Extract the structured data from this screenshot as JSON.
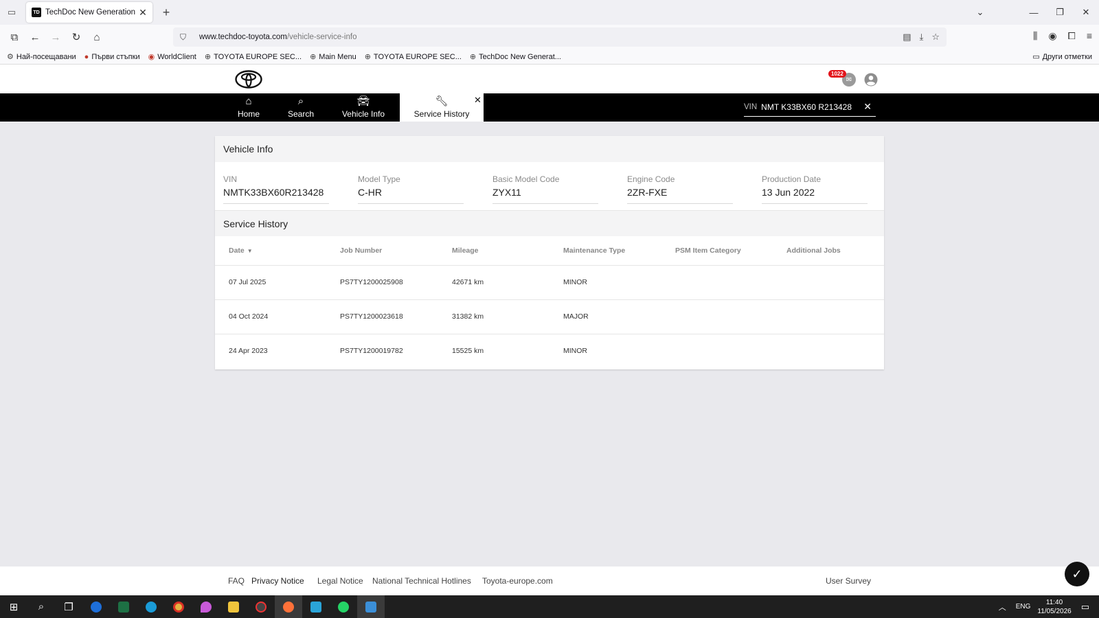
{
  "browser": {
    "tab_title": "TechDoc New Generation",
    "favicon_text": "TD",
    "url_domain": "www.techdoc-toyota.com",
    "url_path": "/vehicle-service-info",
    "bookmarks": [
      {
        "label": "Най-посещавани",
        "icon": "gear-icon"
      },
      {
        "label": "Първи стъпки",
        "icon": "firefox-icon"
      },
      {
        "label": "WorldClient",
        "icon": "worldclient-icon"
      },
      {
        "label": "TOYOTA EUROPE SEC...",
        "icon": "globe-icon"
      },
      {
        "label": "Main Menu",
        "icon": "globe-icon"
      },
      {
        "label": "TOYOTA EUROPE SEC...",
        "icon": "globe-icon"
      },
      {
        "label": "TechDoc New Generat...",
        "icon": "globe-icon"
      }
    ],
    "other_bookmarks": "Други отметки"
  },
  "app": {
    "message_badge": "1022",
    "nav": {
      "home": "Home",
      "search": "Search",
      "vehicle_info": "Vehicle Info",
      "service_history": "Service History"
    },
    "vin_search": {
      "label": "VIN",
      "value": "NMT K33BX60 R213428"
    }
  },
  "vehicle_info": {
    "title": "Vehicle Info",
    "fields": [
      {
        "label": "VIN",
        "value": "NMTK33BX60R213428"
      },
      {
        "label": "Model Type",
        "value": "C-HR"
      },
      {
        "label": "Basic Model Code",
        "value": "ZYX11"
      },
      {
        "label": "Engine Code",
        "value": "2ZR-FXE"
      },
      {
        "label": "Production Date",
        "value": "13 Jun 2022"
      }
    ]
  },
  "service_history": {
    "title": "Service History",
    "columns": [
      "Date",
      "Job Number",
      "Mileage",
      "Maintenance Type",
      "PSM Item Category",
      "Additional Jobs"
    ],
    "rows": [
      [
        "07 Jul 2025",
        "PS7TY1200025908",
        "42671 km",
        "MINOR",
        "",
        ""
      ],
      [
        "04 Oct 2024",
        "PS7TY1200023618",
        "31382 km",
        "MAJOR",
        "",
        ""
      ],
      [
        "24 Apr 2023",
        "PS7TY1200019782",
        "15525 km",
        "MINOR",
        "",
        ""
      ]
    ]
  },
  "footer": {
    "faq": "FAQ",
    "privacy": "Privacy Notice",
    "legal": "Legal Notice",
    "hotlines": "National Technical Hotlines",
    "toyota_europe": "Toyota-europe.com",
    "survey": "User Survey"
  },
  "taskbar": {
    "lang": "ENG",
    "time": "11:40",
    "date": "11/05/2026"
  },
  "colors": {
    "brand_red": "#e3131a",
    "nav_bg": "#000000",
    "page_bg": "#e9e9ed"
  }
}
